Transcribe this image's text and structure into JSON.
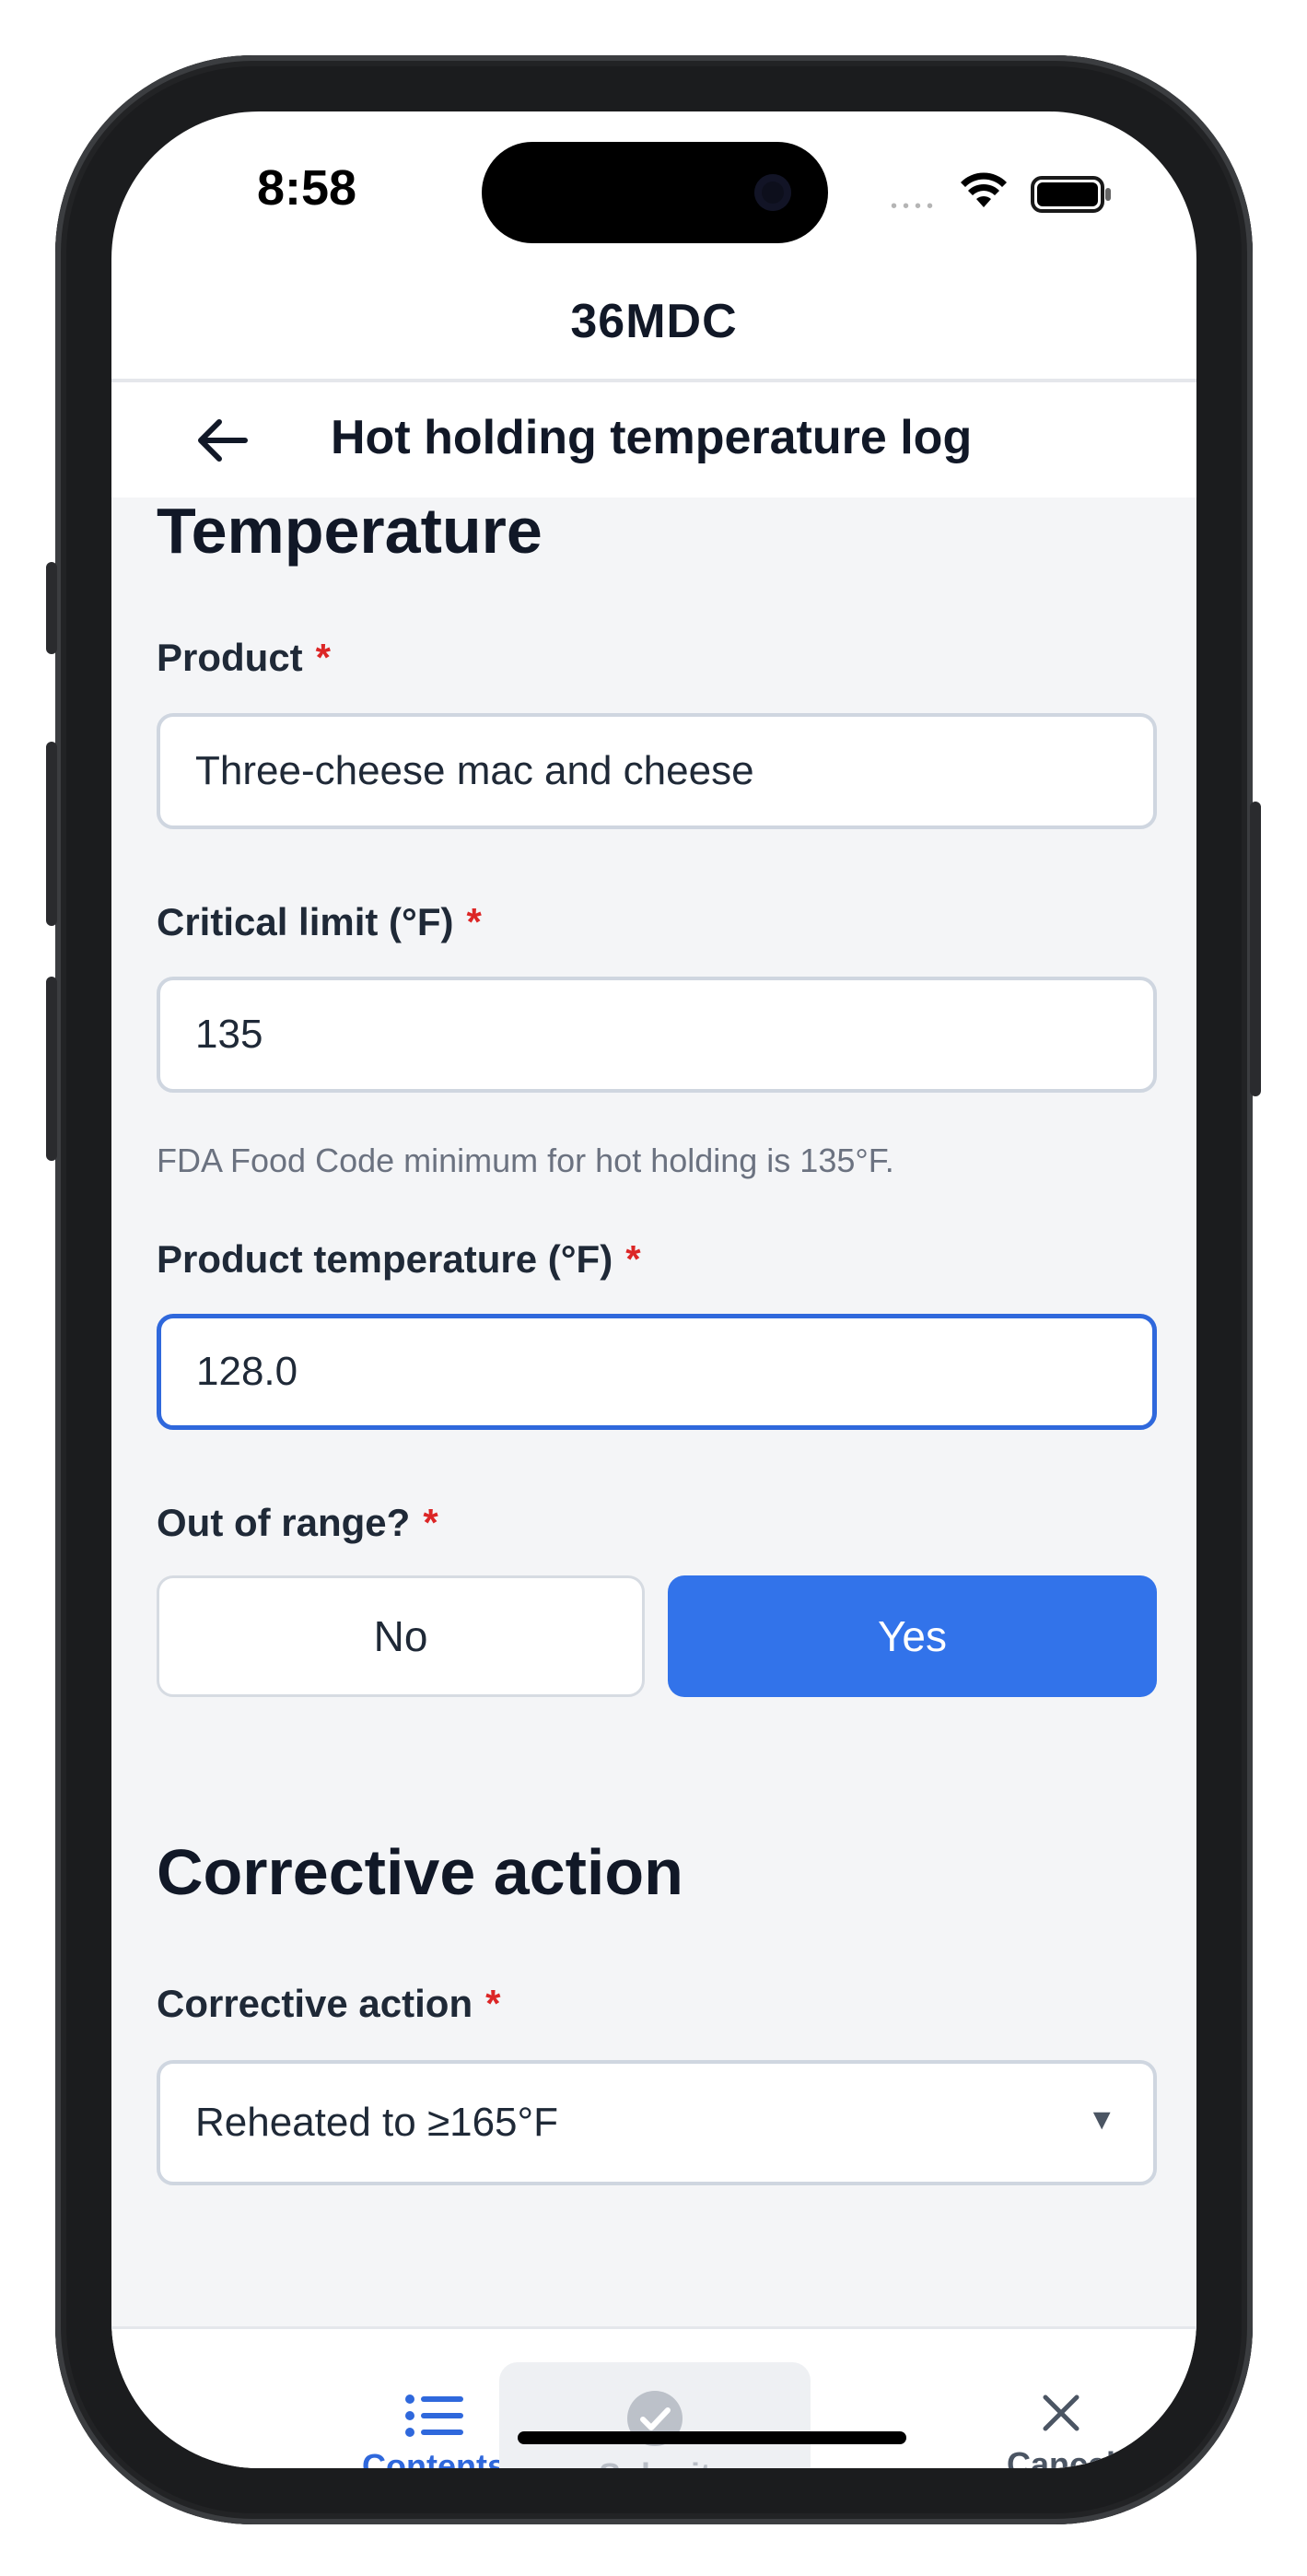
{
  "status_bar": {
    "time": "8:58",
    "dots": "••••"
  },
  "app": {
    "title": "36MDC"
  },
  "nav": {
    "title": "Hot holding temperature log"
  },
  "sections": {
    "temperature": {
      "title": "Temperature"
    },
    "corrective": {
      "title": "Corrective action"
    }
  },
  "fields": {
    "product": {
      "label": "Product",
      "required": "*",
      "value": "Three-cheese mac and cheese"
    },
    "critical_limit": {
      "label": "Critical limit (°F)",
      "required": "*",
      "value": "135",
      "hint": "FDA Food Code minimum for hot holding is 135°F."
    },
    "product_temperature": {
      "label": "Product temperature (°F)",
      "required": "*",
      "value": "128.0"
    },
    "out_of_range": {
      "label": "Out of range?",
      "required": "*",
      "options": [
        "No",
        "Yes"
      ],
      "selected": "Yes"
    },
    "corrective_action": {
      "label": "Corrective action",
      "required": "*",
      "value": "Reheated to ≥165°F",
      "caret": "▼"
    }
  },
  "tabbar": {
    "contents": {
      "label": "Contents"
    },
    "submit": {
      "label": "Submit"
    },
    "cancel": {
      "label": "Cancel"
    }
  },
  "colors": {
    "accent": "#3273ea",
    "required": "#dc2626",
    "text": "#111827",
    "background": "#f4f5f7"
  }
}
